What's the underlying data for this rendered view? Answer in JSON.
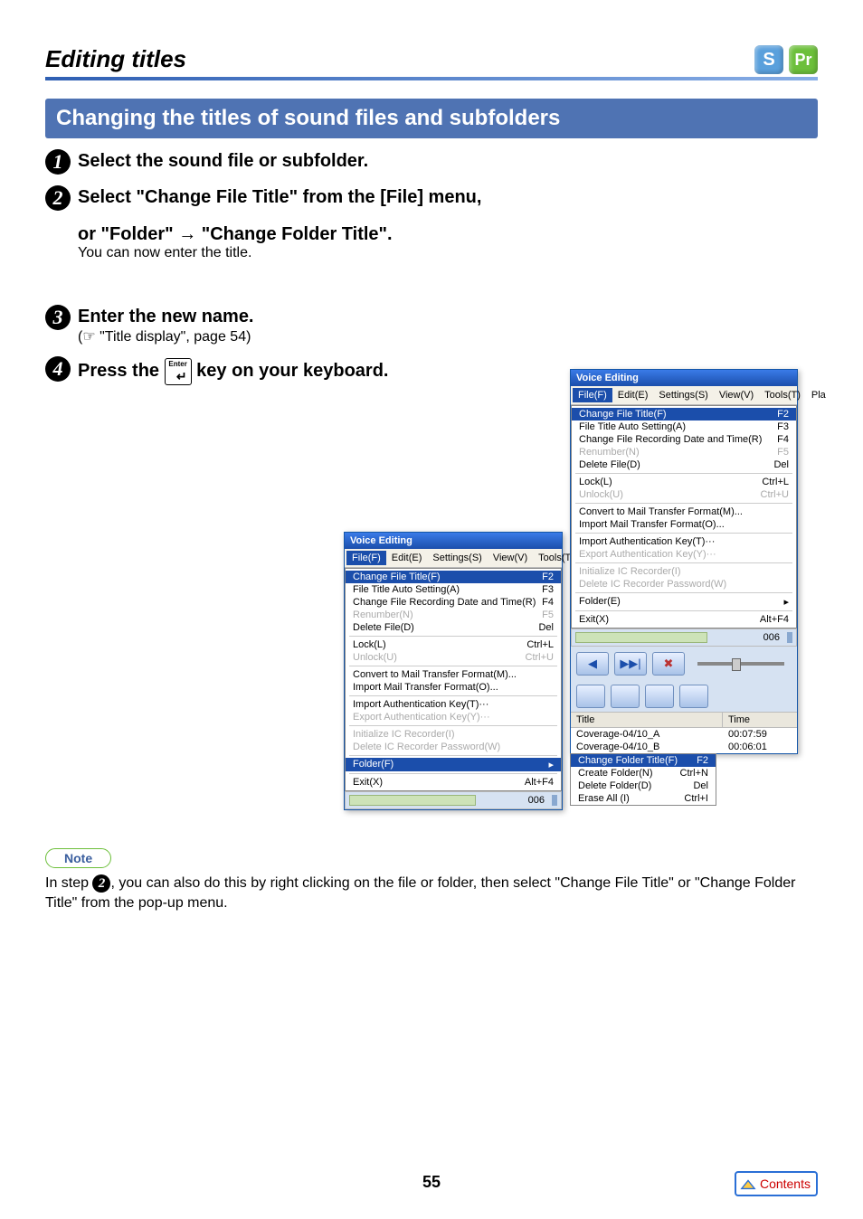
{
  "page_title": "Editing titles",
  "badges": {
    "s": "S",
    "pr": "Pr"
  },
  "section_heading": "Changing the titles of sound files and subfolders",
  "steps": [
    {
      "text": "Select the sound file or subfolder."
    },
    {
      "text_a": "Select \"Change File Title\" from the [File] menu,",
      "text_b": "or \"Folder\" → \"Change Folder Title\".",
      "sub": "You can now enter the title."
    },
    {
      "text": "Enter the new name.",
      "xref_prefix": "(",
      "xref_icon": "☞",
      "xref_text": " \"Title display\", page 54)"
    },
    {
      "text_a": "Press the ",
      "text_b": " key on your keyboard.",
      "key_label": "Enter"
    }
  ],
  "app_title": "Voice Editing",
  "menus": {
    "File": "File(F)",
    "Edit": "Edit(E)",
    "Settings": "Settings(S)",
    "View": "View(V)",
    "Tools": "Tools(T)",
    "Play": "Pla"
  },
  "file_menu_1": [
    {
      "l": "Change File Title(F)",
      "r": "F2",
      "hl": true
    },
    {
      "l": "File Title Auto Setting(A)",
      "r": "F3"
    },
    {
      "l": "Change File Recording Date and Time(R)",
      "r": "F4"
    },
    {
      "l": "Renumber(N)",
      "r": "F5",
      "dis": true
    },
    {
      "l": "Delete File(D)",
      "r": "Del"
    },
    {
      "sep": true
    },
    {
      "l": "Lock(L)",
      "r": "Ctrl+L"
    },
    {
      "l": "Unlock(U)",
      "r": "Ctrl+U",
      "dis": true
    },
    {
      "sep": true
    },
    {
      "l": "Convert to Mail Transfer Format(M)...",
      "r": ""
    },
    {
      "l": "Import Mail Transfer Format(O)...",
      "r": ""
    },
    {
      "sep": true
    },
    {
      "l": "Import Authentication Key(T)···",
      "r": ""
    },
    {
      "l": "Export Authentication Key(Y)···",
      "r": "",
      "dis": true
    },
    {
      "sep": true
    },
    {
      "l": "Initialize IC Recorder(I)",
      "r": "",
      "dis": true
    },
    {
      "l": "Delete IC Recorder Password(W)",
      "r": "",
      "dis": true
    },
    {
      "sep": true
    },
    {
      "l": "Folder(F)",
      "r": "▸",
      "hl": true
    },
    {
      "sep": true
    },
    {
      "l": "Exit(X)",
      "r": "Alt+F4"
    }
  ],
  "file_menu_2": [
    {
      "l": "Change File Title(F)",
      "r": "F2",
      "hl": true
    },
    {
      "l": "File Title Auto Setting(A)",
      "r": "F3"
    },
    {
      "l": "Change File Recording Date and Time(R)",
      "r": "F4"
    },
    {
      "l": "Renumber(N)",
      "r": "F5",
      "dis": true
    },
    {
      "l": "Delete File(D)",
      "r": "Del"
    },
    {
      "sep": true
    },
    {
      "l": "Lock(L)",
      "r": "Ctrl+L"
    },
    {
      "l": "Unlock(U)",
      "r": "Ctrl+U",
      "dis": true
    },
    {
      "sep": true
    },
    {
      "l": "Convert to Mail Transfer Format(M)...",
      "r": ""
    },
    {
      "l": "Import Mail Transfer Format(O)...",
      "r": ""
    },
    {
      "sep": true
    },
    {
      "l": "Import Authentication Key(T)···",
      "r": ""
    },
    {
      "l": "Export Authentication Key(Y)···",
      "r": "",
      "dis": true
    },
    {
      "sep": true
    },
    {
      "l": "Initialize IC Recorder(I)",
      "r": "",
      "dis": true
    },
    {
      "l": "Delete IC Recorder Password(W)",
      "r": "",
      "dis": true
    },
    {
      "sep": true
    },
    {
      "l": "Folder(E)",
      "r": "▸"
    },
    {
      "sep": true
    },
    {
      "l": "Exit(X)",
      "r": "Alt+F4"
    }
  ],
  "progress_label": "006",
  "files_header": {
    "title": "Title",
    "time": "Time"
  },
  "files": [
    {
      "title": "Coverage-04/10_A",
      "time": "00:07:59"
    },
    {
      "title": "Coverage-04/10_B",
      "time": "00:06:01"
    }
  ],
  "folder_submenu": [
    {
      "l": "Change Folder Title(F)",
      "r": "F2",
      "hl": true
    },
    {
      "l": "Create Folder(N)",
      "r": "Ctrl+N"
    },
    {
      "l": "Delete Folder(D)",
      "r": "Del"
    },
    {
      "l": "Erase All (I)",
      "r": "Ctrl+I"
    }
  ],
  "note_label": "Note",
  "note_text_a": "In step ",
  "note_step_ref": "2",
  "note_text_b": ", you can also do this by right clicking on the file or folder, then select \"Change File Title\" or \"Change Folder Title\" from the pop-up menu.",
  "page_number": "55",
  "contents_label": "Contents"
}
